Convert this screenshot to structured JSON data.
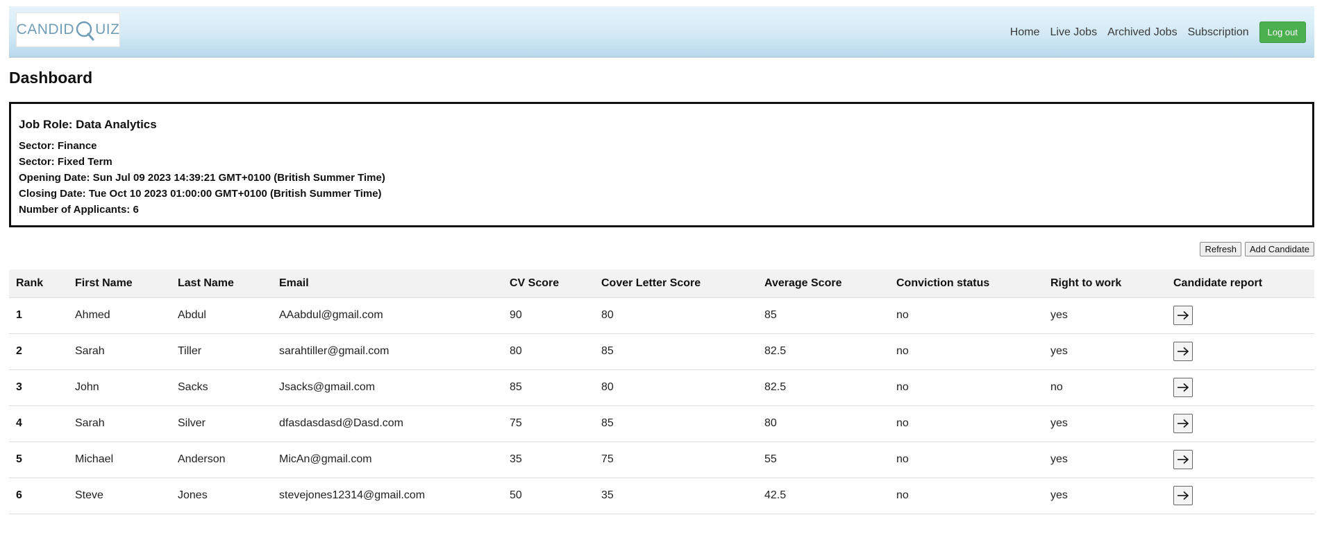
{
  "brand": {
    "logo_text_left": "CANDID",
    "logo_text_right": "UIZ",
    "logo_text": "CANDIDQUIZ",
    "color": "#6f9db8"
  },
  "nav": {
    "links": [
      "Home",
      "Live Jobs",
      "Archived Jobs",
      "Subscription"
    ],
    "logout_label": "Log out",
    "logout_color": "#4caf50"
  },
  "page_title": "Dashboard",
  "job": {
    "role": "Job Role: Data Analytics",
    "sector": "Sector: Finance",
    "sector2": "Sector: Fixed Term",
    "opening_date": "Opening Date: Sun Jul 09 2023 14:39:21 GMT+0100 (British Summer Time)",
    "closing_date": "Closing Date: Tue Oct 10 2023 01:00:00 GMT+0100 (British Summer Time)",
    "applicants": "Number of Applicants: 6"
  },
  "actions": {
    "refresh_label": "Refresh",
    "add_candidate_label": "Add Candidate"
  },
  "table": {
    "columns": [
      "Rank",
      "First Name",
      "Last Name",
      "Email",
      "CV Score",
      "Cover Letter Score",
      "Average Score",
      "Conviction status",
      "Right to work",
      "Candidate report"
    ],
    "rows": [
      [
        "1",
        "Ahmed",
        "Abdul",
        "AAabdul@gmail.com",
        "90",
        "80",
        "85",
        "no",
        "yes"
      ],
      [
        "2",
        "Sarah",
        "Tiller",
        "sarahtiller@gmail.com",
        "80",
        "85",
        "82.5",
        "no",
        "yes"
      ],
      [
        "3",
        "John",
        "Sacks",
        "Jsacks@gmail.com",
        "85",
        "80",
        "82.5",
        "no",
        "no"
      ],
      [
        "4",
        "Sarah",
        "Silver",
        "dfasdasdasd@Dasd.com",
        "75",
        "85",
        "80",
        "no",
        "yes"
      ],
      [
        "5",
        "Michael",
        "Anderson",
        "MicAn@gmail.com",
        "35",
        "75",
        "55",
        "no",
        "yes"
      ],
      [
        "6",
        "Steve",
        "Jones",
        "stevejones12314@gmail.com",
        "50",
        "35",
        "42.5",
        "no",
        "yes"
      ]
    ],
    "report_icon": "arrow-right-icon"
  }
}
